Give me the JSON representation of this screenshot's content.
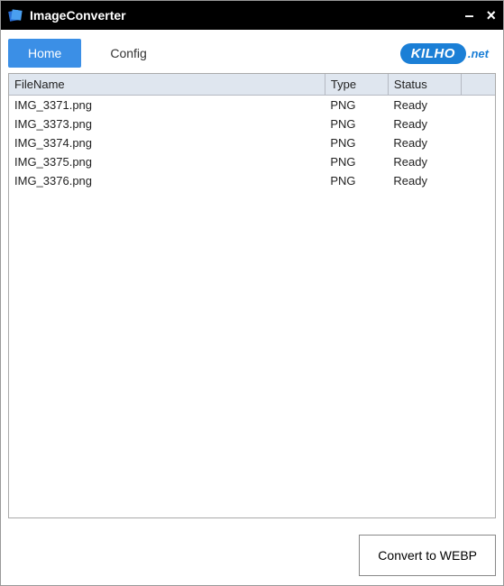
{
  "titlebar": {
    "app_title": "ImageConverter"
  },
  "tabs": {
    "home": "Home",
    "config": "Config"
  },
  "logo": {
    "brand": "KILHO",
    "suffix": ".net"
  },
  "table": {
    "headers": {
      "filename": "FileName",
      "type": "Type",
      "status": "Status",
      "extra": ""
    },
    "rows": [
      {
        "filename": "IMG_3371.png",
        "type": "PNG",
        "status": "Ready"
      },
      {
        "filename": "IMG_3373.png",
        "type": "PNG",
        "status": "Ready"
      },
      {
        "filename": "IMG_3374.png",
        "type": "PNG",
        "status": "Ready"
      },
      {
        "filename": "IMG_3375.png",
        "type": "PNG",
        "status": "Ready"
      },
      {
        "filename": "IMG_3376.png",
        "type": "PNG",
        "status": "Ready"
      }
    ]
  },
  "footer": {
    "convert_label": "Convert to WEBP"
  }
}
